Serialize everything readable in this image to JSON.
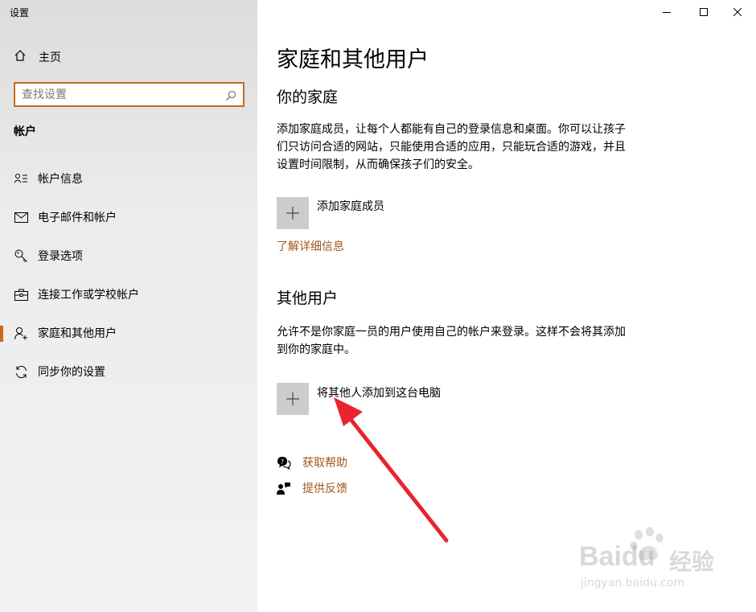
{
  "app": {
    "title": "设置"
  },
  "window": {
    "minimize": "—",
    "maximize": "□",
    "close": "✕"
  },
  "sidebar": {
    "home_label": "主页",
    "search_placeholder": "查找设置",
    "section": "帐户",
    "items": [
      {
        "label": "帐户信息",
        "icon": "account-info-icon"
      },
      {
        "label": "电子邮件和帐户",
        "icon": "mail-icon"
      },
      {
        "label": "登录选项",
        "icon": "key-icon"
      },
      {
        "label": "连接工作或学校帐户",
        "icon": "briefcase-icon"
      },
      {
        "label": "家庭和其他用户",
        "icon": "add-person-icon",
        "active": true
      },
      {
        "label": "同步你的设置",
        "icon": "sync-icon"
      }
    ]
  },
  "main": {
    "title": "家庭和其他用户",
    "family": {
      "heading": "你的家庭",
      "description": "添加家庭成员，让每个人都能有自己的登录信息和桌面。你可以让孩子们只访问合适的网站，只能使用合适的应用，只能玩合适的游戏，并且设置时间限制，从而确保孩子们的安全。",
      "add_label": "添加家庭成员",
      "learn_more": "了解详细信息"
    },
    "others": {
      "heading": "其他用户",
      "description": "允许不是你家庭一员的用户使用自己的帐户来登录。这样不会将其添加到你的家庭中。",
      "add_label": "将其他人添加到这台电脑"
    },
    "help": {
      "get_help": "获取帮助",
      "feedback": "提供反馈"
    }
  },
  "watermark": {
    "brand": "Baidu",
    "brand_cn": "经验",
    "url": "jingyan.baidu.com"
  },
  "colors": {
    "accent": "#c56a1f",
    "link": "#a0561d",
    "arrow": "#e8242e"
  }
}
